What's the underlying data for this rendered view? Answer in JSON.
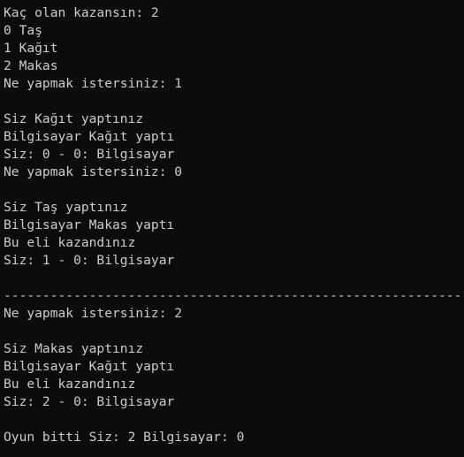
{
  "console": {
    "background": "#0c0c0c",
    "foreground": "#cccccc",
    "lines": [
      "Kaç olan kazansın: 2",
      "0 Taş",
      "1 Kağıt",
      "2 Makas",
      "Ne yapmak istersiniz: 1",
      "",
      "Siz Kağıt yaptınız",
      "Bilgisayar Kağıt yaptı",
      "Siz: 0 - 0: Bilgisayar",
      "Ne yapmak istersiniz: 0",
      "",
      "Siz Taş yaptınız",
      "Bilgisayar Makas yaptı",
      "Bu eli kazandınız",
      "Siz: 1 - 0: Bilgisayar",
      "",
      "------------------------------------------------------------",
      "Ne yapmak istersiniz: 2",
      "",
      "Siz Makas yaptınız",
      "Bilgisayar Kağıt yaptı",
      "Bu eli kazandınız",
      "Siz: 2 - 0: Bilgisayar",
      "",
      "Oyun bitti Siz: 2 Bilgisayar: 0"
    ]
  }
}
